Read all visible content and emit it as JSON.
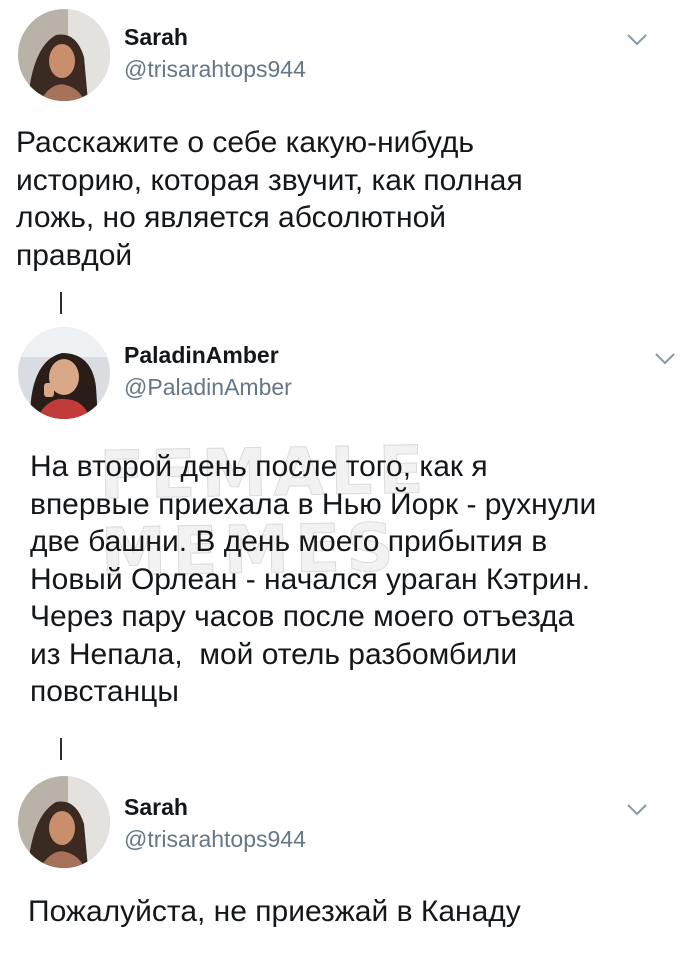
{
  "tweets": [
    {
      "name": "Sarah",
      "handle": "@trisarahtops944",
      "text": "Расскажите о себе какую-нибудь\nисторию, которая звучит, как полная\nложь, но является абсолютной\nправдой"
    },
    {
      "name": "PaladinAmber",
      "handle": "@PaladinAmber",
      "text": "На второй день после того, как я\nвпервые приехала в Нью Йорк - рухнули\nдве башни. В день моего прибытия в\nНовый Орлеан - начался ураган Кэтрин.\nЧерез пару часов после моего отъезда\nиз Непала,  мой отель разбомбили\nповстанцы"
    },
    {
      "name": "Sarah",
      "handle": "@trisarahtops944",
      "text": "Пожалуйста, не приезжай в Канаду"
    }
  ],
  "watermark": "FEMALE MEMES",
  "icons": {
    "menu": "chevron-down-icon",
    "avatar": "avatar"
  },
  "colors": {
    "name": "#14171a",
    "handle": "#657786",
    "chevron": "#8899a6"
  }
}
